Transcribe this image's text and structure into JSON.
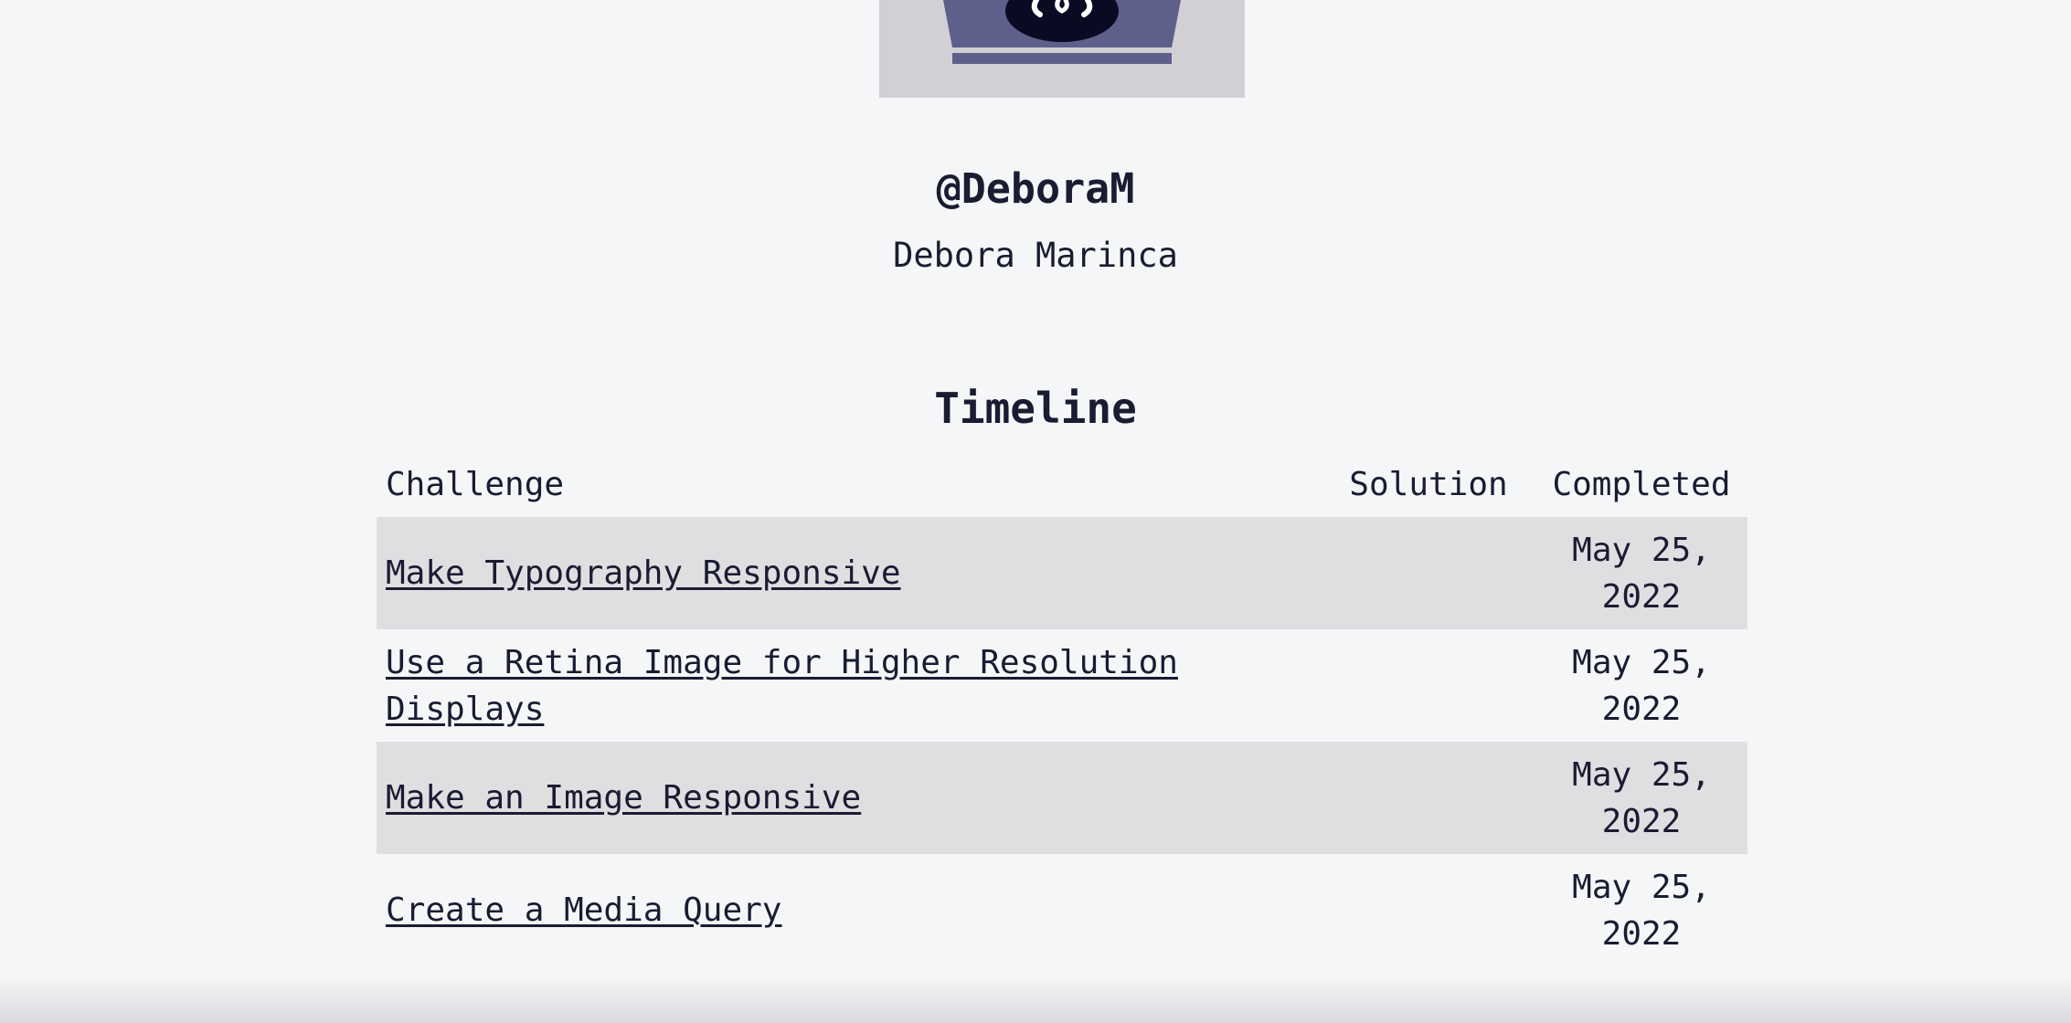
{
  "profile": {
    "username": "@DeboraM",
    "full_name": "Debora Marinca",
    "avatar": "freecodecamp-camper-avatar"
  },
  "timeline": {
    "heading": "Timeline",
    "columns": {
      "challenge": "Challenge",
      "solution": "Solution",
      "completed": "Completed"
    },
    "rows": [
      {
        "challenge": "Make Typography Responsive",
        "solution": "",
        "completed_line1": "May 25,",
        "completed_line2": "2022"
      },
      {
        "challenge": "Use a Retina Image for Higher Resolution Displays",
        "solution": "",
        "completed_line1": "May 25,",
        "completed_line2": "2022"
      },
      {
        "challenge": "Make an Image Responsive",
        "solution": "",
        "completed_line1": "May 25,",
        "completed_line2": "2022"
      },
      {
        "challenge": "Create a Media Query",
        "solution": "",
        "completed_line1": "May 25,",
        "completed_line2": "2022"
      }
    ]
  },
  "colors": {
    "background": "#f5f6f7",
    "text": "#1b1b32",
    "row_stripe": "#dfdfe2",
    "avatar_bg": "#d0d0d5",
    "avatar_accent": "#5f5f8c"
  }
}
